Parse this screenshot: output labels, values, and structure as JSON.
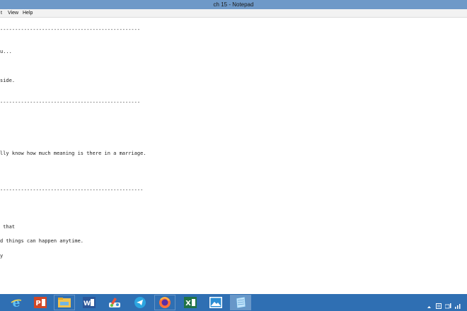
{
  "window": {
    "title": "ch 15 - Notepad"
  },
  "menu": {
    "items": [
      "t",
      "View",
      "Help"
    ]
  },
  "editor": {
    "lines": [
      "-----------------------------------------------",
      "u...",
      "side.",
      "-----------------------------------------------",
      "lly know how much meaning is there in a marriage.",
      "------------------------------------------------",
      " that",
      "d things can happen anytime.",
      "y"
    ]
  },
  "taskbar": {
    "apps": [
      {
        "name": "start-button",
        "icon": "windows-start-icon"
      },
      {
        "name": "internet-explorer",
        "icon": "internet-explorer-icon",
        "color": "#1ea1f1"
      },
      {
        "name": "powerpoint",
        "icon": "powerpoint-icon",
        "color": "#d24726"
      },
      {
        "name": "file-explorer",
        "icon": "folder-icon",
        "color": "#f0c24f"
      },
      {
        "name": "word",
        "icon": "word-icon",
        "color": "#2b579a"
      },
      {
        "name": "paint",
        "icon": "paint-icon",
        "color": "#e8553c"
      },
      {
        "name": "telegram",
        "icon": "telegram-icon",
        "color": "#2ca5e0"
      },
      {
        "name": "firefox",
        "icon": "firefox-icon",
        "color": "#ff7139"
      },
      {
        "name": "excel",
        "icon": "excel-icon",
        "color": "#217346"
      },
      {
        "name": "photos",
        "icon": "photos-icon",
        "color": "#2d8fd5"
      },
      {
        "name": "notepad",
        "icon": "notepad-icon",
        "color": "#9fd3f5"
      }
    ],
    "active_app": "notepad",
    "bg_color": "#2f6fb3"
  },
  "tray": {
    "icons": [
      "show-hidden-icons-chevron",
      "action-center-icon",
      "network-icon",
      "volume-icon"
    ]
  }
}
